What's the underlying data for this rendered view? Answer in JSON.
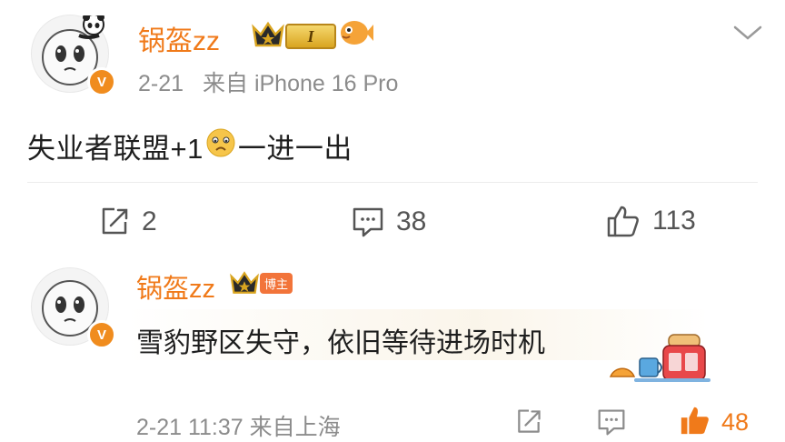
{
  "post": {
    "username": "锅盔zz",
    "level_badge": "I",
    "verified_mark": "V",
    "date": "2-21",
    "source": "来自 iPhone 16 Pro",
    "text_before_emoji": "失业者联盟+1",
    "text_after_emoji": "一进一出",
    "repost_count": "2",
    "comment_count": "38",
    "like_count": "113"
  },
  "comment": {
    "username": "锅盔zz",
    "role_badge": "博主",
    "verified_mark": "V",
    "text": "雪豹野区失守，依旧等待进场时机",
    "timestamp": "2-21 11:37 来自上海",
    "like_count": "48"
  },
  "icons": {
    "username_color": "#f07a1a",
    "accent_orange": "#f08c1e",
    "gold": "#d9a520"
  }
}
